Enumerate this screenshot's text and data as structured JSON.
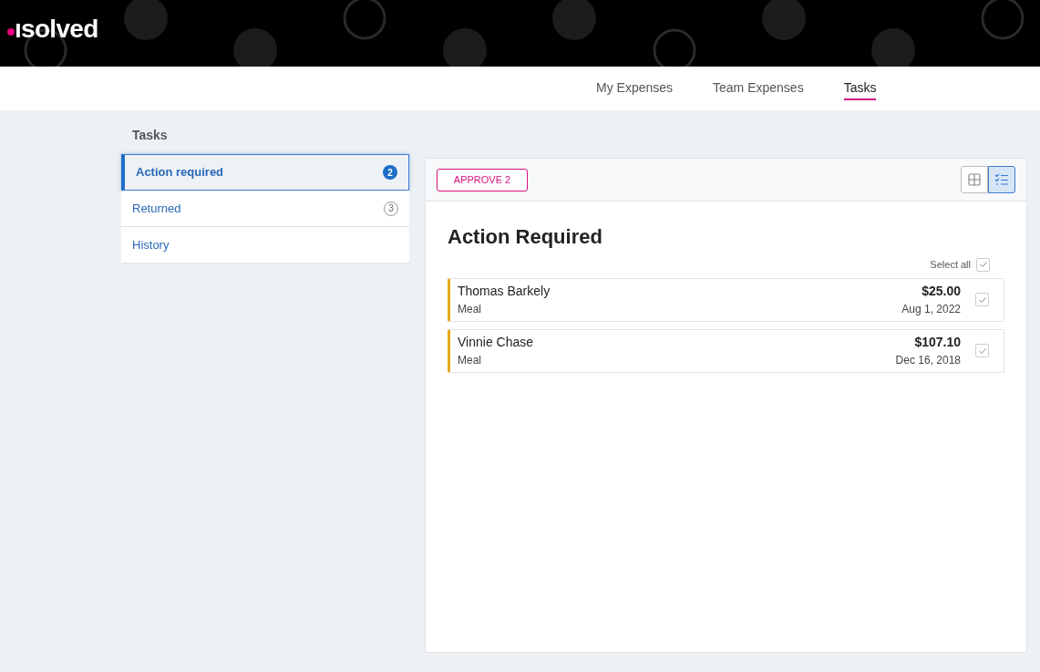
{
  "logo": "ısolved",
  "nav": [
    {
      "label": "My Expenses",
      "selected": false
    },
    {
      "label": "Team Expenses",
      "selected": false
    },
    {
      "label": "Tasks",
      "selected": true
    }
  ],
  "sidebar": {
    "title": "Tasks",
    "items": [
      {
        "label": "Action required",
        "count": "2",
        "selected": true
      },
      {
        "label": "Returned",
        "count": "3",
        "selected": false
      },
      {
        "label": "History",
        "selected": false
      }
    ]
  },
  "toolbar": {
    "approve_button": "APPROVE 2",
    "views": [
      {
        "kind": "grid",
        "selected": false
      },
      {
        "kind": "checklist",
        "selected": true
      }
    ]
  },
  "content": {
    "heading": "Action Required",
    "select_all": {
      "label": "Select all",
      "checked": true
    },
    "expenses": [
      {
        "name": "Thomas Barkely",
        "category": "Meal",
        "amount": "$25.00",
        "date": "Aug 1, 2022",
        "checked": true
      },
      {
        "name": "Vinnie Chase",
        "category": "Meal",
        "amount": "$107.10",
        "date": "Dec 16, 2018",
        "checked": true
      }
    ]
  }
}
